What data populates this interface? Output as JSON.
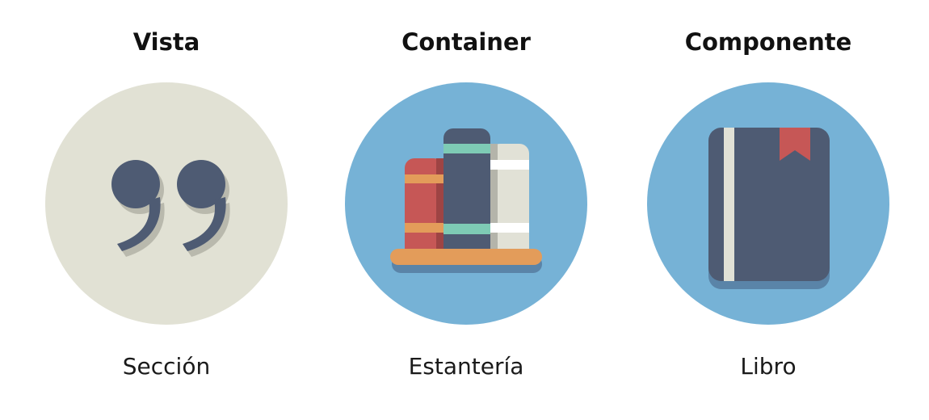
{
  "colors": {
    "vista_circle": "#e1e1d4",
    "blue_circle": "#76b2d6",
    "navy": "#4e5b73",
    "shadow": "#b9b9ad",
    "red": "#c65756",
    "orange": "#e39c5a",
    "teal": "#7ecbb5",
    "cream": "#e1e1d6",
    "white": "#ffffff"
  },
  "columns": [
    {
      "heading": "Vista",
      "icon": "quote-icon",
      "caption": "Sección"
    },
    {
      "heading": "Container",
      "icon": "bookshelf-icon",
      "caption": "Estantería"
    },
    {
      "heading": "Componente",
      "icon": "book-icon",
      "caption": "Libro"
    }
  ]
}
